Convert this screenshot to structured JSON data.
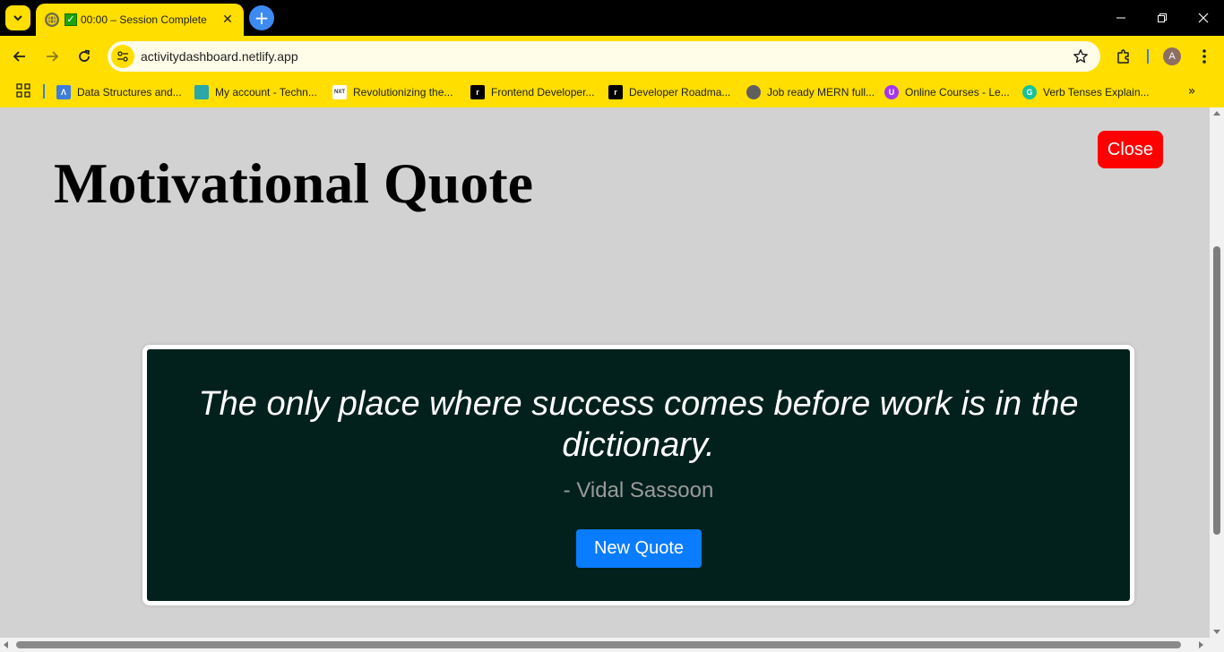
{
  "browser": {
    "tab": {
      "title": "00:00 – Session Complete",
      "check_glyph": "✓"
    },
    "address_bar": {
      "url": "activitydashboard.netlify.app"
    },
    "profile_initial": "A",
    "bookmarks": [
      {
        "label": "Data Structures and...",
        "icon": "lambda-icon",
        "color": "#3d7ddb"
      },
      {
        "label": "My account - Techn...",
        "icon": "tech-logo-icon",
        "color": "#2aa7a7"
      },
      {
        "label": "Revolutionizing the...",
        "icon": "nxt-wave-icon",
        "color": "#ffffff"
      },
      {
        "label": "Frontend Developer...",
        "icon": "roadmap-icon",
        "color": "#000000"
      },
      {
        "label": "Developer Roadma...",
        "icon": "roadmap-icon",
        "color": "#000000"
      },
      {
        "label": "Job ready MERN full...",
        "icon": "globe-icon",
        "color": "#5f5f5f"
      },
      {
        "label": "Online Courses - Le...",
        "icon": "udemy-icon",
        "color": "#a435f0"
      },
      {
        "label": "Verb Tenses Explain...",
        "icon": "grammarly-icon",
        "color": "#15c39a"
      }
    ],
    "bookmarks_overflow": "»"
  },
  "page": {
    "title": "Motivational Quote",
    "close_label": "Close",
    "quote": {
      "text": "The only place where success comes before work is in the dictionary.",
      "author": "- Vidal Sassoon"
    },
    "new_quote_label": "New Quote"
  },
  "colors": {
    "browser_accent": "#ffde00",
    "close_button": "#ff0000",
    "card_background": "#02211c",
    "new_quote_button": "#0a7cff",
    "page_background": "#d3d2d3"
  }
}
